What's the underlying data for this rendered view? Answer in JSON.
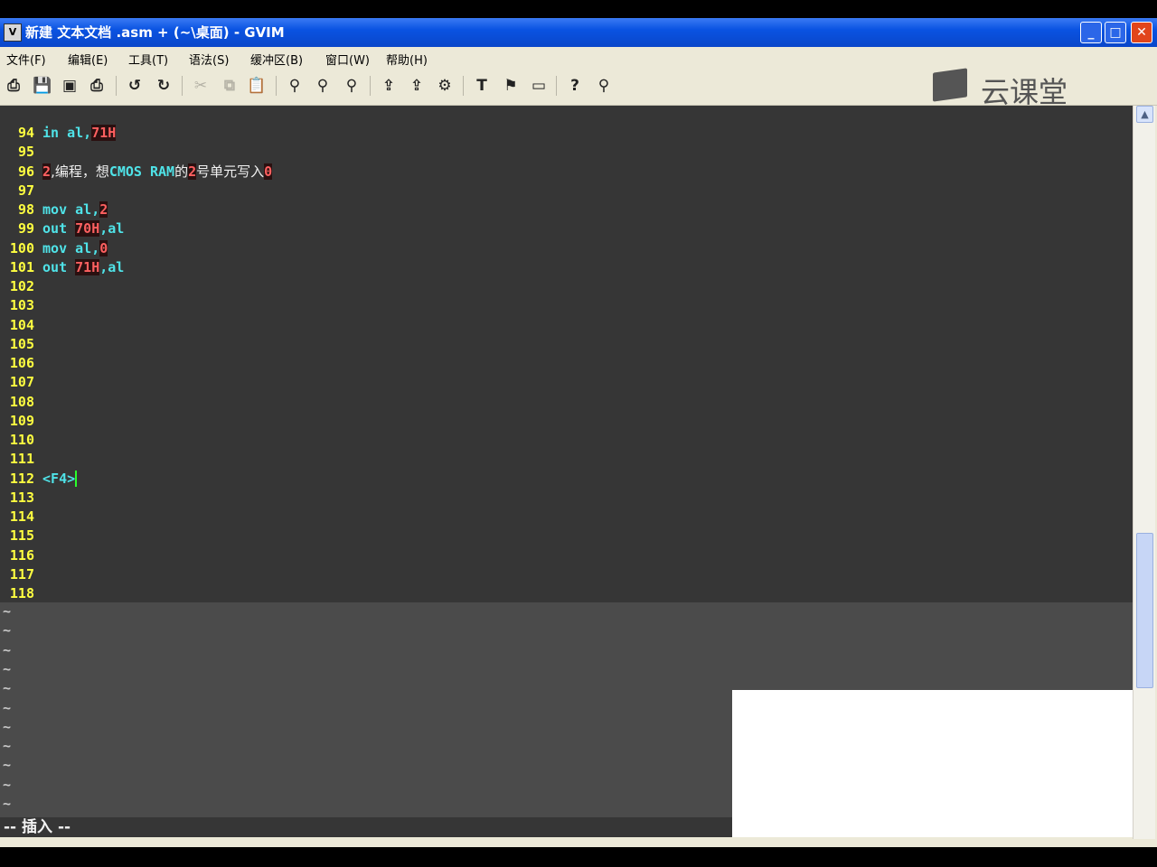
{
  "window": {
    "title": "新建 文本文档 .asm + (~\\桌面) - GVIM",
    "icon_letter": "V",
    "minimize": "_",
    "maximize": "□",
    "close": "✕"
  },
  "menu": [
    "文件(F)",
    "编辑(E)",
    "工具(T)",
    "语法(S)",
    "缓冲区(B)",
    "窗口(W)",
    "帮助(H)"
  ],
  "toolbar_icons": [
    "open-icon",
    "save-icon",
    "save-all-icon",
    "print-icon",
    "undo-icon",
    "redo-icon",
    "cut-icon",
    "copy-icon",
    "paste-icon",
    "find-replace-icon",
    "find-next-icon",
    "find-prev-icon",
    "load-session-icon",
    "save-session-icon",
    "run-script-icon",
    "make-icon",
    "build-tags-icon",
    "jump-tag-icon",
    "help-icon",
    "find-help-icon"
  ],
  "toolbar_glyphs": [
    "⎙",
    "💾",
    "▣",
    "⎙",
    "↺",
    "↻",
    "✂",
    "⧉",
    "📋",
    "⚲",
    "⚲",
    "⚲",
    "⇪",
    "⇪",
    "⚙",
    "T",
    "⚑",
    "▭",
    "?",
    "⚲"
  ],
  "logo": {
    "text": "云课堂"
  },
  "lines": [
    {
      "n": "94",
      "segments": [
        {
          "t": "in al,",
          "c": "code"
        },
        {
          "t": "71H",
          "c": "num"
        }
      ]
    },
    {
      "n": "95",
      "segments": []
    },
    {
      "n": "96",
      "segments": [
        {
          "t": "2",
          "c": "num"
        },
        {
          "t": ",编程，想",
          "c": "txt"
        },
        {
          "t": "CMOS RAM",
          "c": "code"
        },
        {
          "t": "的",
          "c": "txt"
        },
        {
          "t": "2",
          "c": "num"
        },
        {
          "t": "号单元写入",
          "c": "txt"
        },
        {
          "t": "0",
          "c": "num"
        }
      ]
    },
    {
      "n": "97",
      "segments": []
    },
    {
      "n": "98",
      "segments": [
        {
          "t": "mov al,",
          "c": "code"
        },
        {
          "t": "2",
          "c": "num"
        }
      ]
    },
    {
      "n": "99",
      "segments": [
        {
          "t": "out ",
          "c": "code"
        },
        {
          "t": "70H",
          "c": "num"
        },
        {
          "t": ",al",
          "c": "code"
        }
      ]
    },
    {
      "n": "100",
      "segments": [
        {
          "t": "mov al,",
          "c": "code"
        },
        {
          "t": "0",
          "c": "num"
        }
      ]
    },
    {
      "n": "101",
      "segments": [
        {
          "t": "out ",
          "c": "code"
        },
        {
          "t": "71H",
          "c": "num"
        },
        {
          "t": ",al",
          "c": "code"
        }
      ]
    },
    {
      "n": "102",
      "segments": []
    },
    {
      "n": "103",
      "segments": []
    },
    {
      "n": "104",
      "segments": []
    },
    {
      "n": "105",
      "segments": []
    },
    {
      "n": "106",
      "segments": []
    },
    {
      "n": "107",
      "segments": []
    },
    {
      "n": "108",
      "segments": []
    },
    {
      "n": "109",
      "segments": []
    },
    {
      "n": "110",
      "segments": []
    },
    {
      "n": "111",
      "segments": []
    },
    {
      "n": "112",
      "segments": [
        {
          "t": "<F4>",
          "c": "code"
        }
      ],
      "cursor": true
    },
    {
      "n": "113",
      "segments": []
    },
    {
      "n": "114",
      "segments": []
    },
    {
      "n": "115",
      "segments": []
    },
    {
      "n": "116",
      "segments": []
    },
    {
      "n": "117",
      "segments": []
    },
    {
      "n": "118",
      "segments": []
    }
  ],
  "tilde_count": 12,
  "tilde_char": "~",
  "status": "-- 插入 --",
  "colors": {
    "linenr": "#ffff40",
    "code": "#4fe3e8",
    "number": "#ff6060",
    "background": "#363636"
  }
}
